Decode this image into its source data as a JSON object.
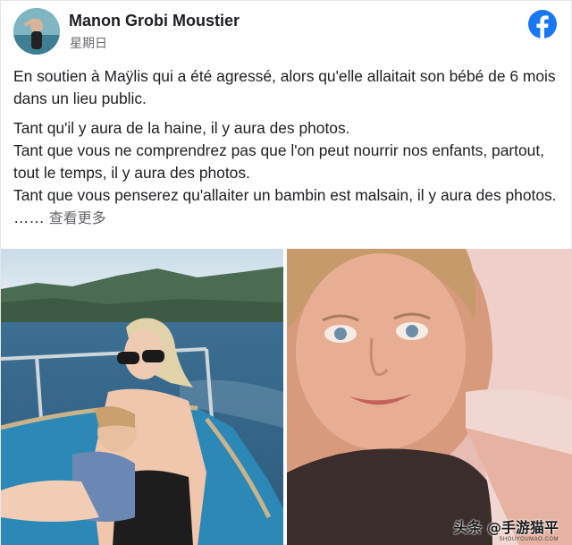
{
  "post": {
    "author": "Manon Grobi Moustier",
    "timestamp": "星期日",
    "platform_icon": "facebook-icon",
    "paragraph1": "En soutien à Maÿlis qui a été agressé, alors qu'elle allaitait son bébé de 6 mois dans un lieu public.",
    "line1": "Tant qu'il y aura de la haine, il y aura des photos.",
    "line2": "Tant que vous ne comprendrez pas que l'on peut nourrir nos enfants, partout, tout le temps, il y aura des photos.",
    "line3": "Tant que vous penserez qu'allaiter un bambin est malsain, il y aura des photos. ……",
    "see_more": "查看更多"
  },
  "photos": [
    {
      "name": "photo-boat-breastfeeding"
    },
    {
      "name": "photo-selfie"
    }
  ],
  "watermark": {
    "text": "头条 @手游猫平",
    "subtext": "SHOUYOUMAO.COM"
  },
  "colors": {
    "facebook_blue": "#1877f2",
    "text": "#1c1e21",
    "secondary_text": "#65676b"
  }
}
